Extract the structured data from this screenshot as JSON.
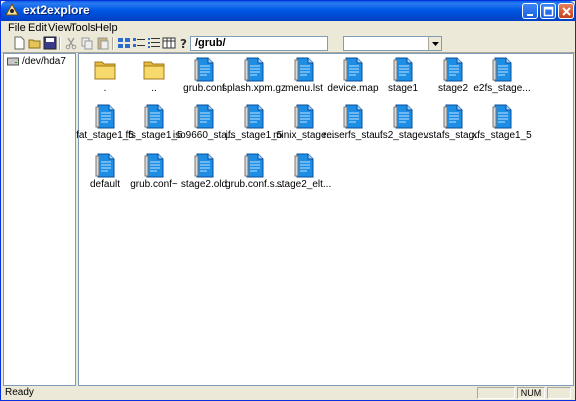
{
  "window": {
    "title": "ext2explore"
  },
  "menu": {
    "items": [
      {
        "label": "File"
      },
      {
        "label": "Edit"
      },
      {
        "label": "View"
      },
      {
        "label": "Tools"
      },
      {
        "label": "Help"
      }
    ]
  },
  "toolbar": {
    "path_value": "/grub/",
    "combo_value": ""
  },
  "tree": {
    "items": [
      {
        "label": "/dev/hda7"
      }
    ]
  },
  "files": {
    "items": [
      {
        "label": ".",
        "icon": "folder-icon"
      },
      {
        "label": "..",
        "icon": "folder-icon"
      },
      {
        "label": "grub.conf",
        "icon": "file-icon"
      },
      {
        "label": "splash.xpm.gz",
        "icon": "file-icon"
      },
      {
        "label": "menu.lst",
        "icon": "file-icon"
      },
      {
        "label": "device.map",
        "icon": "file-icon"
      },
      {
        "label": "stage1",
        "icon": "file-icon"
      },
      {
        "label": "stage2",
        "icon": "file-icon"
      },
      {
        "label": "e2fs_stage...",
        "icon": "file-icon"
      },
      {
        "label": "fat_stage1_5",
        "icon": "file-icon"
      },
      {
        "label": "ffs_stage1_5",
        "icon": "file-icon"
      },
      {
        "label": "iso9660_sta...",
        "icon": "file-icon"
      },
      {
        "label": "jfs_stage1_5",
        "icon": "file-icon"
      },
      {
        "label": "minix_stage...",
        "icon": "file-icon"
      },
      {
        "label": "reiserfs_sta...",
        "icon": "file-icon"
      },
      {
        "label": "ufs2_stage...",
        "icon": "file-icon"
      },
      {
        "label": "vstafs_stag...",
        "icon": "file-icon"
      },
      {
        "label": "xfs_stage1_5",
        "icon": "file-icon"
      },
      {
        "label": "default",
        "icon": "file-icon"
      },
      {
        "label": "grub.conf~",
        "icon": "file-icon"
      },
      {
        "label": "stage2.old",
        "icon": "file-icon"
      },
      {
        "label": "grub.conf.s...",
        "icon": "file-icon"
      },
      {
        "label": "stage2_elt...",
        "icon": "file-icon"
      }
    ]
  },
  "status": {
    "text": "Ready",
    "num": "NUM"
  },
  "colors": {
    "title_bar": "#0058e6",
    "chrome": "#ece9d8",
    "folder": "#f5d36a",
    "file_page": "#1c8ee6"
  }
}
